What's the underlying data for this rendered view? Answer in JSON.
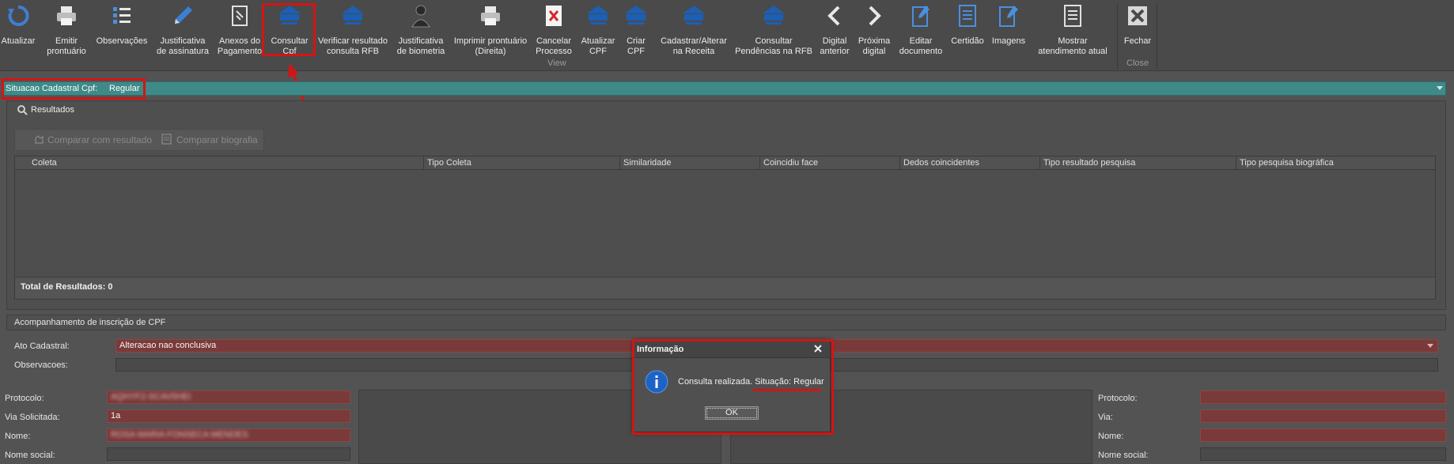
{
  "ribbon": {
    "buttons": [
      {
        "label": "Atualizar",
        "icon": "refresh-icon"
      },
      {
        "label": "Emitir\nprontuário",
        "icon": "printer-icon"
      },
      {
        "label": "Observações",
        "icon": "checklist-icon"
      },
      {
        "label": "Justificativa\nde assinatura",
        "icon": "pen-icon"
      },
      {
        "label": "Anexos do\nPagamento",
        "icon": "attachment-doc-icon"
      },
      {
        "label": "Consultar\nCpf",
        "icon": "receita-federal-icon"
      },
      {
        "label": "Verificar resultado\nconsulta RFB",
        "icon": "receita-federal-icon"
      },
      {
        "label": "Justificativa\nde biometria",
        "icon": "person-icon"
      },
      {
        "label": "Imprimir prontuário\n(Direita)",
        "icon": "printer-icon"
      },
      {
        "label": "Cancelar\nProcesso",
        "icon": "cancel-doc-icon"
      },
      {
        "label": "Atualizar\nCPF",
        "icon": "receita-federal-icon"
      },
      {
        "label": "Criar\nCPF",
        "icon": "receita-federal-icon"
      },
      {
        "label": "Cadastrar/Alterar\nna Receita",
        "icon": "receita-federal-icon"
      },
      {
        "label": "Consultar\nPendências na RFB",
        "icon": "receita-federal-icon"
      },
      {
        "label": "Digital\nanterior",
        "icon": "chevron-left-icon"
      },
      {
        "label": "Próxima\ndigital",
        "icon": "chevron-right-icon"
      },
      {
        "label": "Editar\ndocumento",
        "icon": "edit-doc-icon"
      },
      {
        "label": "Certidão",
        "icon": "certificate-icon"
      },
      {
        "label": "Imagens",
        "icon": "image-edit-icon"
      },
      {
        "label": "Mostrar\natendimento atual",
        "icon": "document-icon"
      },
      {
        "label": "Fechar",
        "icon": "close-x-icon"
      }
    ],
    "group_view": "View",
    "group_close": "Close"
  },
  "situacao": {
    "label": "Situacao Cadastral Cpf:",
    "value": "Regular"
  },
  "results": {
    "title": "Resultados",
    "toolbar": {
      "compare_result": "Comparar com resultado",
      "compare_bio": "Comparar biografia"
    },
    "columns": [
      "Coleta",
      "Tipo Coleta",
      "Similaridade",
      "Coincidiu face",
      "Dedos coincidentes",
      "Tipo resultado pesquisa",
      "Tipo pesquisa biográfica"
    ],
    "total": "Total de Resultados: 0"
  },
  "acompanhamento": {
    "title": "Acompanhamento de inscrição de CPF",
    "ato_label": "Ato Cadastral:",
    "ato_value": "Alteracao nao conclusiva",
    "obs_label": "Observacoes:"
  },
  "left_form": {
    "protocolo_label": "Protocolo:",
    "protocolo_value": "AQHYF2-SCAV5HEI",
    "via_label": "Via Solicitada:",
    "via_value": "1a",
    "nome_label": "Nome:",
    "nome_value": "ROSA MARIA FONSECA MENDES",
    "nome_social_label": "Nome social:"
  },
  "right_form": {
    "protocolo_label": "Protocolo:",
    "via_label": "Via:",
    "nome_label": "Nome:",
    "nome_social_label": "Nome social:"
  },
  "dialog": {
    "title": "Informação",
    "message": "Consulta realizada. Situação: Regular",
    "ok": "OK"
  },
  "colors": {
    "accent_teal": "#3e8a88",
    "highlight_red": "#d41414",
    "field_red": "#7a3a3a",
    "rfb_blue": "#1c5fb4"
  }
}
